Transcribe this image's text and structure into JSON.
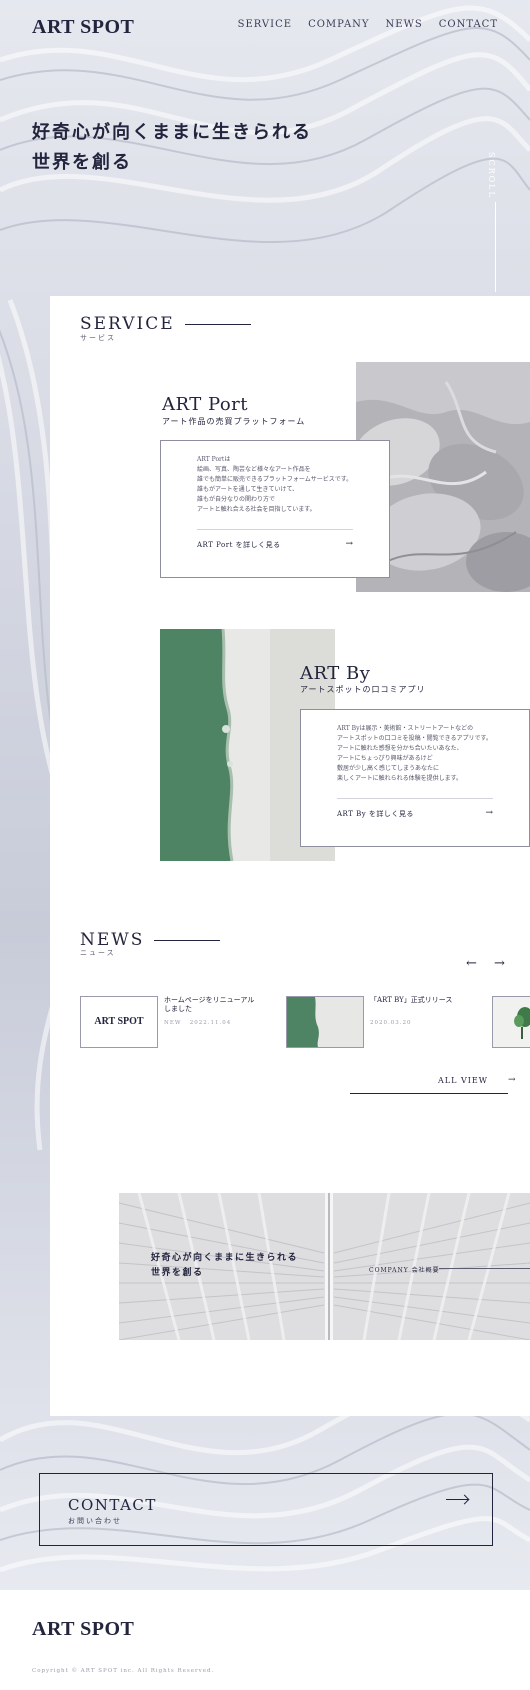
{
  "header": {
    "logo": "ART SPOT",
    "nav": [
      "SERVICE",
      "COMPANY",
      "NEWS",
      "CONTACT"
    ]
  },
  "hero": {
    "copy_line1": "好奇心が向くままに生きられる",
    "copy_line2": "世界を創る",
    "scroll_label": "SCROLL"
  },
  "service": {
    "title": "SERVICE",
    "subtitle": "サービス",
    "items": [
      {
        "name": "ART Port",
        "tagline": "アート作品の売買プラットフォーム",
        "description": [
          "ART Portは",
          "絵画、写真、陶芸など様々なアート作品を",
          "誰でも簡単に販売できるプラットフォームサービスです。",
          "誰もがアートを通して生きていけて、",
          "誰もが自分なりの関わり方で",
          "アートと触れ合える社会を目指しています。"
        ],
        "link": "ART Port を詳しく見る",
        "arrow": "→"
      },
      {
        "name": "ART By",
        "tagline": "アートスポットの口コミアプリ",
        "description": [
          "ART Byは展示・美術館・ストリートアートなどの",
          "アートスポットの口コミを投稿・閲覧できるアプリです。",
          "アートに触れた感想を分かち合いたいあなた、",
          "アートにちょっぴり興味があるけど",
          "敷居が少し高く感じてしまうあなたに",
          "楽しくアートに触れられる体験を提供します。"
        ],
        "link": "ART By を詳しく見る",
        "arrow": "→"
      }
    ]
  },
  "news": {
    "title": "NEWS",
    "subtitle": "ニュース",
    "prev": "←",
    "next": "→",
    "items": [
      {
        "thumb_text": "ART SPOT",
        "title": "ホームページをリニューアルしました",
        "tag": "NEW",
        "date": "2022.11.04"
      },
      {
        "thumb_text": "",
        "title": "「ART BY」正式リリース",
        "tag": "",
        "date": "2020.03.20"
      }
    ],
    "all_view": "ALL VIEW",
    "all_view_arrow": "→"
  },
  "banner": {
    "copy_line1": "好奇心が向くままに生きられる",
    "copy_line2": "世界を創る",
    "company_link": "COMPANY 会社概要"
  },
  "contact": {
    "title": "CONTACT",
    "subtitle": "お問い合わせ"
  },
  "footer": {
    "logo": "ART SPOT",
    "copyright": "Copyright © ART SPOT inc. All Rights Reserved."
  }
}
